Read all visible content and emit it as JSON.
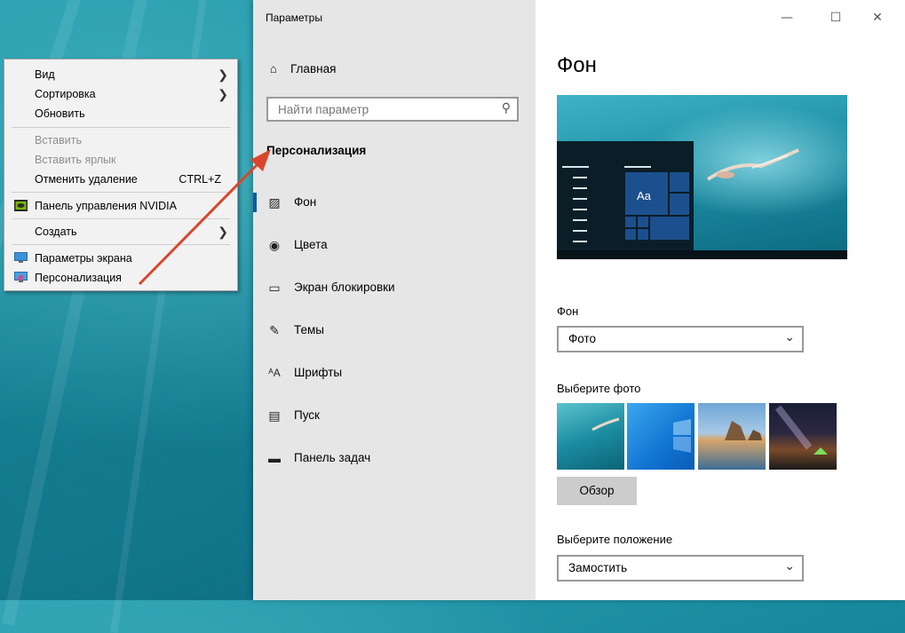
{
  "context_menu": {
    "items": [
      {
        "label": "Вид",
        "submenu": true,
        "disabled": false
      },
      {
        "label": "Сортировка",
        "submenu": true,
        "disabled": false
      },
      {
        "label": "Обновить",
        "submenu": false,
        "disabled": false
      },
      {
        "label": "Вставить",
        "submenu": false,
        "disabled": true
      },
      {
        "label": "Вставить ярлык",
        "submenu": false,
        "disabled": true
      },
      {
        "label": "Отменить удаление",
        "shortcut": "CTRL+Z",
        "submenu": false,
        "disabled": false
      },
      {
        "label": "Панель управления NVIDIA",
        "icon": "nvidia-icon",
        "submenu": false,
        "disabled": false
      },
      {
        "label": "Создать",
        "submenu": true,
        "disabled": false
      },
      {
        "label": "Параметры экрана",
        "icon": "display-settings-icon",
        "submenu": false,
        "disabled": false
      },
      {
        "label": "Персонализация",
        "icon": "personalization-icon",
        "submenu": false,
        "disabled": false
      }
    ]
  },
  "window": {
    "title": "Параметры",
    "controls": {
      "minimize": "—",
      "maximize": "☐",
      "close": "✕"
    }
  },
  "sidebar": {
    "home_label": "Главная",
    "search_placeholder": "Найти параметр",
    "section_title": "Персонализация",
    "items": [
      {
        "label": "Фон",
        "icon": "background-icon",
        "active": true
      },
      {
        "label": "Цвета",
        "icon": "palette-icon",
        "active": false
      },
      {
        "label": "Экран блокировки",
        "icon": "lock-screen-icon",
        "active": false
      },
      {
        "label": "Темы",
        "icon": "themes-icon",
        "active": false
      },
      {
        "label": "Шрифты",
        "icon": "fonts-icon",
        "active": false
      },
      {
        "label": "Пуск",
        "icon": "start-icon",
        "active": false
      },
      {
        "label": "Панель задач",
        "icon": "taskbar-icon",
        "active": false
      }
    ]
  },
  "main": {
    "heading": "Фон",
    "preview_tile_text": "Aa",
    "background_label": "Фон",
    "background_value": "Фото",
    "choose_photo_label": "Выберите фото",
    "browse_button": "Обзор",
    "position_label": "Выберите положение",
    "position_value": "Замостить"
  },
  "colors": {
    "accent": "#0a5aa8",
    "annotation_arrow": "#d9472b",
    "sidebar_bg": "#e6e6e6"
  }
}
